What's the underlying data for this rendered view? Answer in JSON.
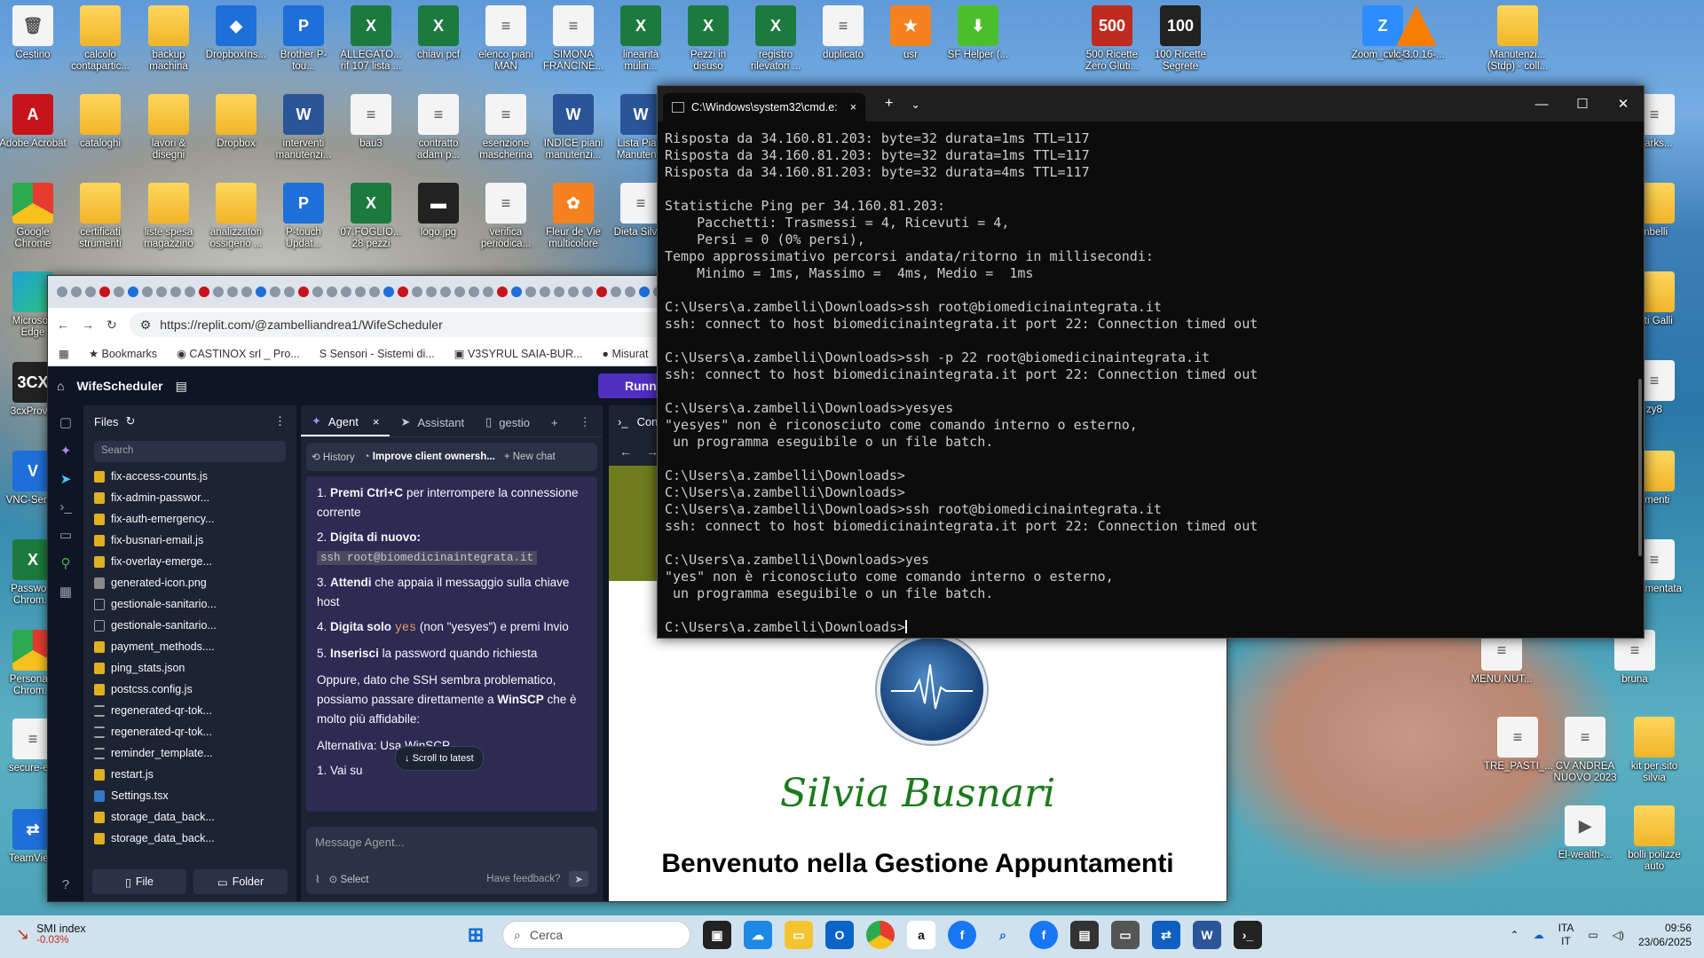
{
  "desktop": {
    "icons": [
      {
        "label": "Cestino",
        "kind": "g-doc",
        "glyph": "🗑"
      },
      {
        "label": "calcolo contapartic...",
        "kind": "g-folder",
        "glyph": ""
      },
      {
        "label": "backup machina",
        "kind": "g-folder",
        "glyph": ""
      },
      {
        "label": "DropboxIns...",
        "kind": "g-blue",
        "glyph": "◆"
      },
      {
        "label": "Brother P-tou...",
        "kind": "g-blue",
        "glyph": "P"
      },
      {
        "label": "ALLEGATO... rif 107 lista ...",
        "kind": "g-excel",
        "glyph": "X"
      },
      {
        "label": "chiavi pcf",
        "kind": "g-excel",
        "glyph": "X"
      },
      {
        "label": "elenco piani MAN",
        "kind": "g-doc",
        "glyph": "≡"
      },
      {
        "label": "SIMONA FRANCINE...",
        "kind": "g-doc",
        "glyph": "≡"
      },
      {
        "label": "linearità mulin...",
        "kind": "g-excel",
        "glyph": "X"
      },
      {
        "label": "Pezzi in disuso",
        "kind": "g-excel",
        "glyph": "X"
      },
      {
        "label": "registro rilevatori ...",
        "kind": "g-excel",
        "glyph": "X"
      },
      {
        "label": "duplicato",
        "kind": "g-doc",
        "glyph": "≡"
      },
      {
        "label": "usr",
        "kind": "g-orange",
        "glyph": "★"
      },
      {
        "label": "SF Helper (...",
        "kind": "g-green",
        "glyph": "⬇"
      },
      {
        "label": "500 Ricette Zero Gluti...",
        "kind": "g-red",
        "glyph": "500"
      },
      {
        "label": "100 Ricette Segrete",
        "kind": "g-dark",
        "glyph": "100"
      },
      {
        "label": "Zoom_cm_f...",
        "kind": "g-zoom",
        "glyph": "Z"
      },
      {
        "label": "vlc-3.0.16-...",
        "kind": "g-vlc",
        "glyph": ""
      },
      {
        "label": "Manutenzi... (Stdp) - coll...",
        "kind": "g-folder",
        "glyph": ""
      },
      {
        "label": "Adobe Acrobat",
        "kind": "g-pdf",
        "glyph": "A"
      },
      {
        "label": "cataloghi",
        "kind": "g-folder",
        "glyph": ""
      },
      {
        "label": "lavori & disegni",
        "kind": "g-folder",
        "glyph": ""
      },
      {
        "label": "Dropbox",
        "kind": "g-folder",
        "glyph": ""
      },
      {
        "label": "interventi manutenzi...",
        "kind": "g-word",
        "glyph": "W"
      },
      {
        "label": "bau3",
        "kind": "g-doc",
        "glyph": "≡"
      },
      {
        "label": "contratto adam p...",
        "kind": "g-doc",
        "glyph": "≡"
      },
      {
        "label": "esenzione mascherina",
        "kind": "g-doc",
        "glyph": "≡"
      },
      {
        "label": "INDICE piani manutenzi...",
        "kind": "g-word",
        "glyph": "W"
      },
      {
        "label": "Lista Piani Manuten...",
        "kind": "g-word",
        "glyph": "W"
      },
      {
        "label": "Google Chrome",
        "kind": "g-chrome",
        "glyph": ""
      },
      {
        "label": "certificati strumenti",
        "kind": "g-folder",
        "glyph": ""
      },
      {
        "label": "liste spesa magazzino",
        "kind": "g-folder",
        "glyph": ""
      },
      {
        "label": "analizzatori ossigeno ...",
        "kind": "g-folder",
        "glyph": ""
      },
      {
        "label": "P-touch Updat...",
        "kind": "g-blue",
        "glyph": "P"
      },
      {
        "label": "07.FOGLIO... 28 pezzi",
        "kind": "g-excel",
        "glyph": "X"
      },
      {
        "label": "logo.jpg",
        "kind": "g-dark",
        "glyph": "▬"
      },
      {
        "label": "verifica periodica...",
        "kind": "g-doc",
        "glyph": "≡"
      },
      {
        "label": "Fleur de Vie multicolore",
        "kind": "g-orange",
        "glyph": "✿"
      },
      {
        "label": "Dieta Silvi...",
        "kind": "g-doc",
        "glyph": "≡"
      },
      {
        "label": "Microsoft Edge",
        "kind": "g-edge",
        "glyph": ""
      },
      {
        "label": "3cxProv...",
        "kind": "g-dark",
        "glyph": "3CX"
      },
      {
        "label": "VNC-Serv...",
        "kind": "g-blue",
        "glyph": "V"
      },
      {
        "label": "Passwo... Chrom...",
        "kind": "g-excel",
        "glyph": "X"
      },
      {
        "label": "Persona... Chrom...",
        "kind": "g-chrome",
        "glyph": ""
      },
      {
        "label": "secure-e...",
        "kind": "g-doc",
        "glyph": "≡"
      },
      {
        "label": "TeamVie...",
        "kind": "g-blue",
        "glyph": "⇄"
      },
      {
        "label": "marks...",
        "kind": "g-doc",
        "glyph": "≡"
      },
      {
        "label": "mbelli",
        "kind": "g-folder",
        "glyph": ""
      },
      {
        "label": "etti Galli",
        "kind": "g-folder",
        "glyph": ""
      },
      {
        "label": "zy8",
        "kind": "g-doc",
        "glyph": "≡"
      },
      {
        "label": "rimenti",
        "kind": "g-folder",
        "glyph": ""
      },
      {
        "label": "zzy mentata",
        "kind": "g-doc",
        "glyph": "≡"
      },
      {
        "label": "MENU NUT...",
        "kind": "g-doc",
        "glyph": "≡"
      },
      {
        "label": "bruna",
        "kind": "g-doc",
        "glyph": "≡"
      },
      {
        "label": "TRE_PASTI_...",
        "kind": "g-doc",
        "glyph": "≡"
      },
      {
        "label": "CV ANDREA NUOVO 2023",
        "kind": "g-doc",
        "glyph": "≡"
      },
      {
        "label": "kit per sito silvia",
        "kind": "g-folder",
        "glyph": ""
      },
      {
        "label": "El-wealth-...",
        "kind": "g-doc",
        "glyph": "▶"
      },
      {
        "label": "bolli polizze auto",
        "kind": "g-folder",
        "glyph": ""
      }
    ]
  },
  "browser": {
    "url": "https://replit.com/@zambelliandrea1/WifeScheduler",
    "bookmarks": [
      "Bookmarks",
      "CASTINOX srl _ Pro...",
      "Sensori - Sistemi di...",
      "V3SYRUL SAIA-BUR...",
      "Misurat"
    ],
    "replit": {
      "project": "WifeScheduler",
      "run_label": "Runn",
      "files_title": "Files",
      "search_placeholder": "Search",
      "files": [
        "fix-access-counts.js",
        "fix-admin-passwor...",
        "fix-auth-emergency...",
        "fix-busnari-email.js",
        "fix-overlay-emerge...",
        "generated-icon.png",
        "gestionale-sanitario...",
        "gestionale-sanitario...",
        "payment_methods....",
        "ping_stats.json",
        "postcss.config.js",
        "regenerated-qr-tok...",
        "regenerated-qr-tok...",
        "reminder_template...",
        "restart.js",
        "Settings.tsx",
        "storage_data_back...",
        "storage_data_back..."
      ],
      "file_btn": "File",
      "folder_btn": "Folder",
      "tabs": {
        "agent": "Agent",
        "assistant": "Assistant",
        "gestio": "gestio",
        "console": "Console"
      },
      "chatbar": {
        "history": "History",
        "improve": "Improve client ownersh...",
        "new_chat": "New chat"
      },
      "steps": [
        {
          "n": "1.",
          "bold": "Premi Ctrl+C",
          "rest": " per interrompere la connessione corrente"
        },
        {
          "n": "2.",
          "bold": "Digita di nuovo:",
          "rest": ""
        },
        {
          "n": "3.",
          "bold": "Attendi",
          "rest": " che appaia il messaggio sulla chiave host"
        },
        {
          "n": "4.",
          "bold": "Digita solo",
          "rest": "(non \"yesyes\") e premi Invio"
        },
        {
          "n": "5.",
          "bold": "Inserisci",
          "rest": " la password quando richiesta"
        }
      ],
      "code_ssh": "ssh root@biomedicinaintegrata.it",
      "code_yes": "yes",
      "para_before": "Oppure, dato che SSH sembra problematico, possiamo passare direttamente a ",
      "para_bold": "WinSCP",
      "para_after": " che è molto più affidabile:",
      "alt": "Alternativa: Usa WinSCP",
      "alt_step": "1. Vai su",
      "scroll_latest": "Scroll to latest",
      "msg_placeholder": "Message Agent...",
      "select": "Select",
      "feedback": "Have feedback?",
      "site_name": "Silvia Busnari",
      "site_welcome": "Benvenuto nella Gestione Appuntamenti"
    }
  },
  "cmd": {
    "title": "C:\\Windows\\system32\\cmd.e:",
    "lines": [
      "Risposta da 34.160.81.203: byte=32 durata=1ms TTL=117",
      "Risposta da 34.160.81.203: byte=32 durata=1ms TTL=117",
      "Risposta da 34.160.81.203: byte=32 durata=4ms TTL=117",
      "",
      "Statistiche Ping per 34.160.81.203:",
      "    Pacchetti: Trasmessi = 4, Ricevuti = 4,",
      "    Persi = 0 (0% persi),",
      "Tempo approssimativo percorsi andata/ritorno in millisecondi:",
      "    Minimo = 1ms, Massimo =  4ms, Medio =  1ms",
      "",
      "C:\\Users\\a.zambelli\\Downloads>ssh root@biomedicinaintegrata.it",
      "ssh: connect to host biomedicinaintegrata.it port 22: Connection timed out",
      "",
      "C:\\Users\\a.zambelli\\Downloads>ssh -p 22 root@biomedicinaintegrata.it",
      "ssh: connect to host biomedicinaintegrata.it port 22: Connection timed out",
      "",
      "C:\\Users\\a.zambelli\\Downloads>yesyes",
      "\"yesyes\" non è riconosciuto come comando interno o esterno,",
      " un programma eseguibile o un file batch.",
      "",
      "C:\\Users\\a.zambelli\\Downloads>",
      "C:\\Users\\a.zambelli\\Downloads>",
      "C:\\Users\\a.zambelli\\Downloads>ssh root@biomedicinaintegrata.it",
      "ssh: connect to host biomedicinaintegrata.it port 22: Connection timed out",
      "",
      "C:\\Users\\a.zambelli\\Downloads>yes",
      "\"yes\" non è riconosciuto come comando interno o esterno,",
      " un programma eseguibile o un file batch.",
      "",
      "C:\\Users\\a.zambelli\\Downloads>"
    ]
  },
  "taskbar": {
    "stock_name": "SMI index",
    "stock_change": "-0.03%",
    "search": "Cerca",
    "lang1": "ITA",
    "lang2": "IT",
    "time": "09:56",
    "date": "23/06/2025"
  }
}
